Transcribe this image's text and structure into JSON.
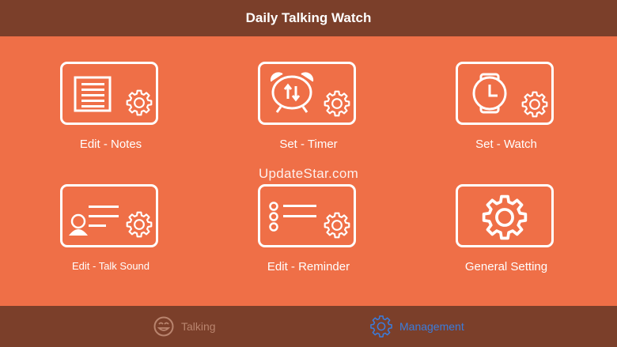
{
  "header": {
    "title": "Daily Talking Watch"
  },
  "tiles": [
    {
      "label": "Edit - Notes",
      "icon": "notes-settings-icon"
    },
    {
      "label": "Set - Timer",
      "icon": "alarm-clock-settings-icon"
    },
    {
      "label": "Set - Watch",
      "icon": "watch-settings-icon"
    },
    {
      "label": "Edit - Talk Sound",
      "icon": "speaker-settings-icon"
    },
    {
      "label": "Edit - Reminder",
      "icon": "checklist-settings-icon"
    },
    {
      "label": "General Setting",
      "icon": "gear-icon"
    }
  ],
  "watermark": "UpdateStar.com",
  "tabs": [
    {
      "label": "Talking",
      "icon": "smiley-face-icon",
      "state": "inactive"
    },
    {
      "label": "Management",
      "icon": "gear-icon",
      "state": "active"
    }
  ],
  "colors": {
    "background": "#EF6F47",
    "bar": "#7B3F2A",
    "active_tab": "#3B7CDB",
    "inactive_tab": "#B9846E"
  }
}
